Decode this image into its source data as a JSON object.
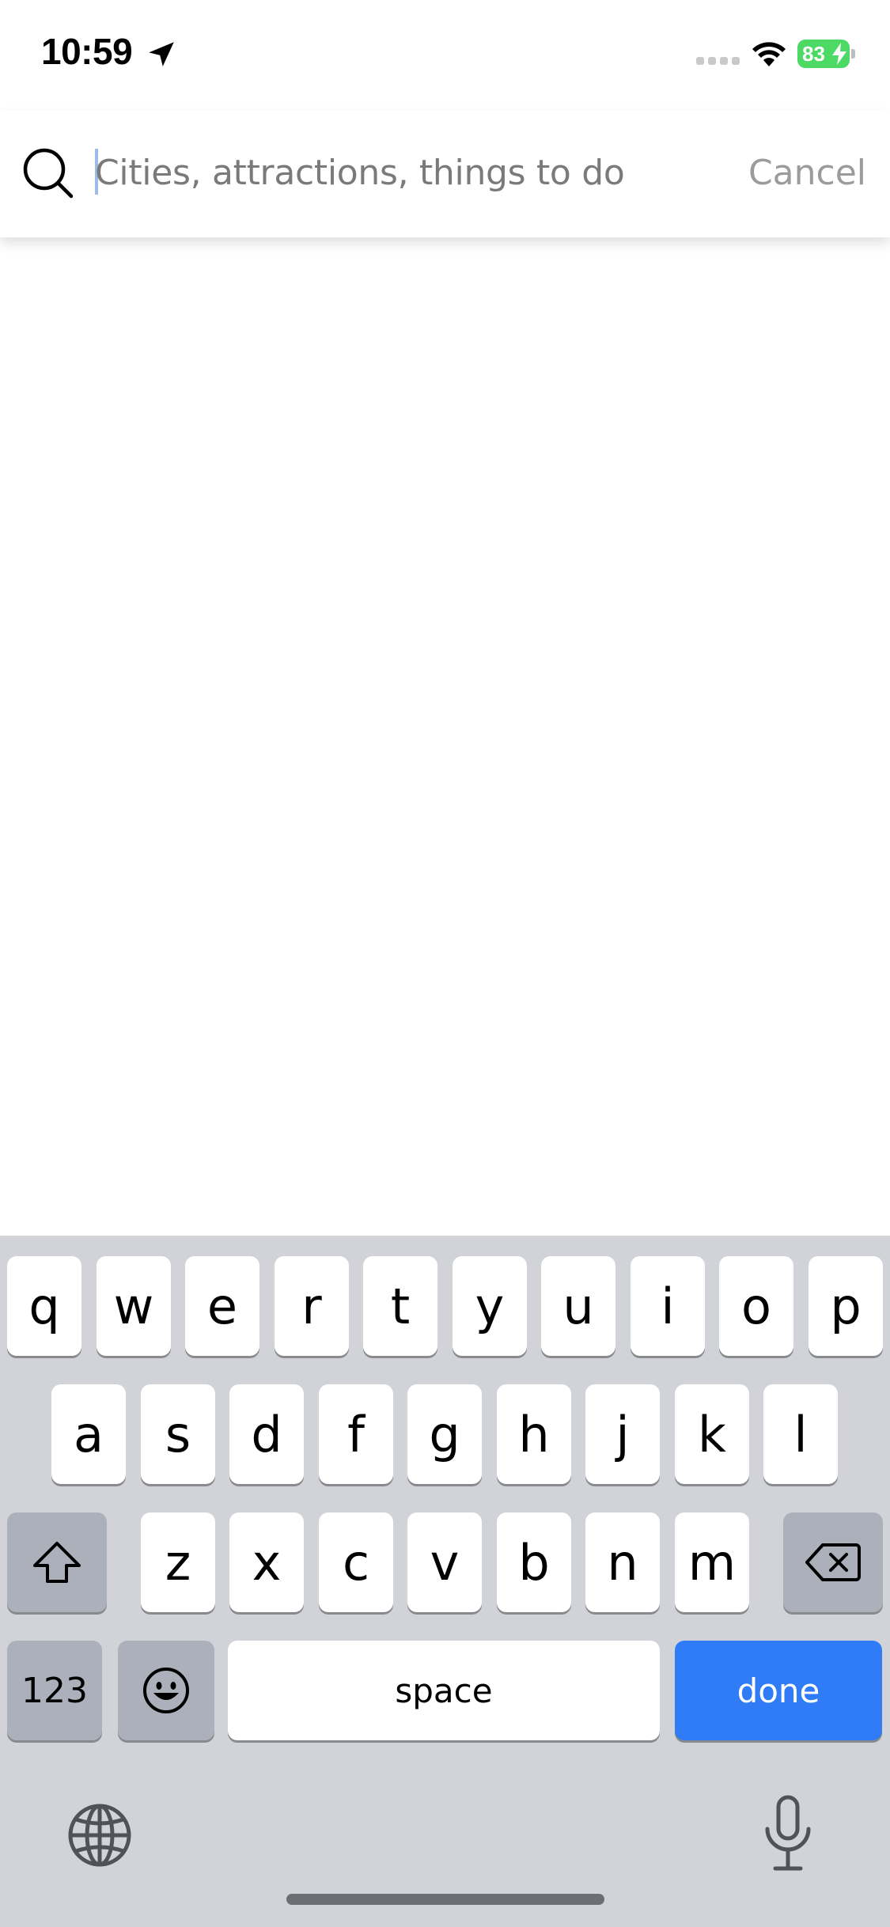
{
  "status_bar": {
    "time": "10:59",
    "battery_level": "83",
    "battery_color": "#4cd964"
  },
  "search": {
    "placeholder": "Cities, attractions, things to do",
    "value": "",
    "cancel_label": "Cancel"
  },
  "keyboard": {
    "row1": [
      "q",
      "w",
      "e",
      "r",
      "t",
      "y",
      "u",
      "i",
      "o",
      "p"
    ],
    "row2": [
      "a",
      "s",
      "d",
      "f",
      "g",
      "h",
      "j",
      "k",
      "l"
    ],
    "row3": [
      "z",
      "x",
      "c",
      "v",
      "b",
      "n",
      "m"
    ],
    "numbers_label": "123",
    "space_label": "space",
    "done_label": "done",
    "done_color": "#2f7cf6"
  },
  "icons": {
    "search": "search-icon",
    "location": "location-arrow-icon",
    "signal": "cellular-signal-icon",
    "wifi": "wifi-icon",
    "battery": "battery-icon",
    "shift": "shift-icon",
    "backspace": "backspace-icon",
    "emoji": "emoji-icon",
    "globe": "globe-icon",
    "mic": "microphone-icon"
  }
}
